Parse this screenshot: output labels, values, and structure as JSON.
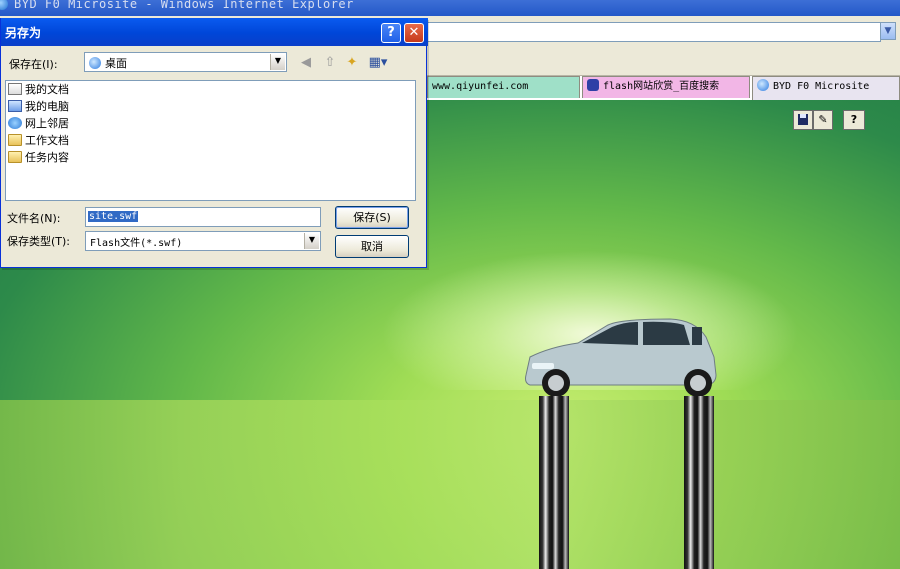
{
  "browser": {
    "window_title": "BYD F0 Microsite - Windows Internet Explorer",
    "tabs": [
      {
        "label": "www.qiyunfei.com"
      },
      {
        "label": "flash网站欣赏_百度搜索"
      },
      {
        "label": "BYD F0 Microsite"
      }
    ]
  },
  "flash": {
    "toolbar": {
      "help_label": "?"
    }
  },
  "dialog": {
    "title": "另存为",
    "title_help": "?",
    "title_close": "✕",
    "save_in_label": "保存在(I):",
    "save_in_value": "桌面",
    "places": [
      {
        "label": "我的文档",
        "icon": "my-documents-icon"
      },
      {
        "label": "我的电脑",
        "icon": "my-computer-icon"
      },
      {
        "label": "网上邻居",
        "icon": "network-places-icon"
      },
      {
        "label": "工作文档",
        "icon": "folder-icon"
      },
      {
        "label": "任务内容",
        "icon": "folder-icon"
      }
    ],
    "filename_label": "文件名(N):",
    "filename_value": "site.swf",
    "filetype_label": "保存类型(T):",
    "filetype_value": "Flash文件(*.swf)",
    "save_button": "保存(S)",
    "cancel_button": "取消"
  }
}
